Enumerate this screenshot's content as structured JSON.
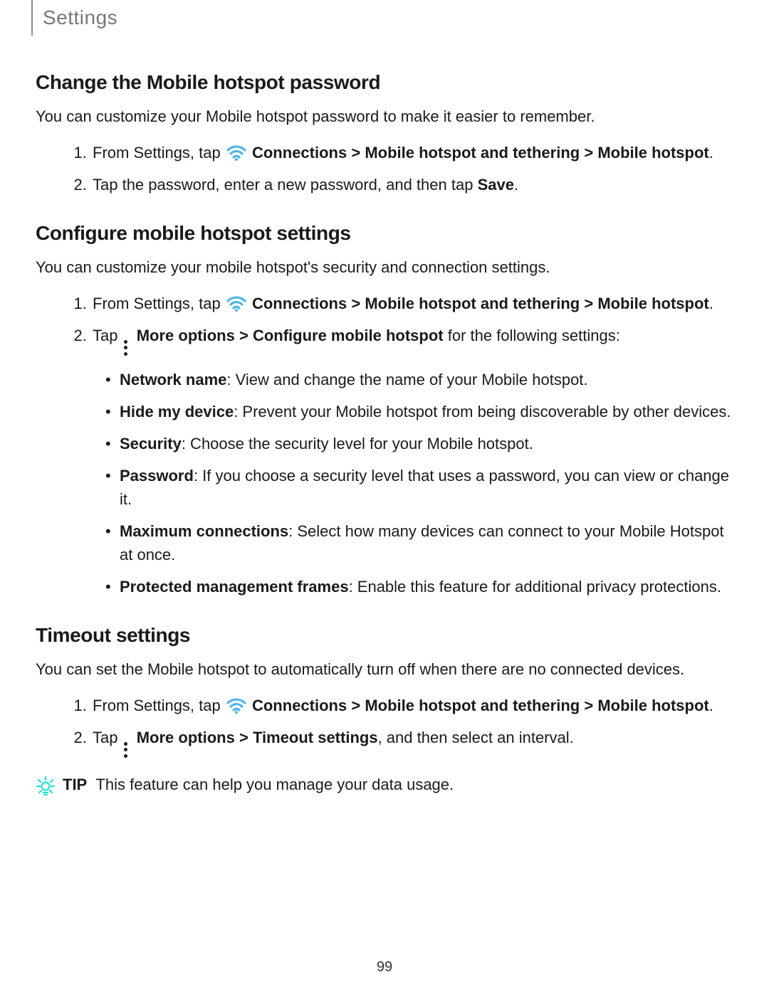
{
  "header": {
    "section": "Settings"
  },
  "sections": {
    "s1": {
      "title": "Change the Mobile hotspot password",
      "intro": "You can customize your Mobile hotspot password to make it easier to remember.",
      "step1_a": "From Settings, tap ",
      "step1_b": "Connections",
      "step1_c": "Mobile hotspot and tethering",
      "step1_d": "Mobile hotspot",
      "step2_a": "Tap the password, enter a new password, and then tap ",
      "step2_b": "Save"
    },
    "s2": {
      "title": "Configure mobile hotspot settings",
      "intro": "You can customize your mobile hotspot's security and connection settings.",
      "step1_a": "From Settings, tap ",
      "step1_b": "Connections",
      "step1_c": "Mobile hotspot and tethering",
      "step1_d": "Mobile hotspot",
      "step2_a": "Tap ",
      "step2_b": "More options",
      "step2_c": "Configure mobile hotspot",
      "step2_d": " for the following settings:",
      "bullets": {
        "b1a": "Network name",
        "b1b": ": View and change the name of your Mobile hotspot.",
        "b2a": "Hide my device",
        "b2b": ": Prevent your Mobile hotspot from being discoverable by other devices.",
        "b3a": "Security",
        "b3b": ": Choose the security level for your Mobile hotspot.",
        "b4a": "Password",
        "b4b": ": If you choose a security level that uses a password, you can view or change it.",
        "b5a": "Maximum connections",
        "b5b": ": Select how many devices can connect to your Mobile Hotspot at once.",
        "b6a": "Protected management frames",
        "b6b": ": Enable this feature for additional privacy protections."
      }
    },
    "s3": {
      "title": "Timeout settings",
      "intro": "You can set the Mobile hotspot to automatically turn off when there are no connected devices.",
      "step1_a": "From Settings, tap ",
      "step1_b": "Connections",
      "step1_c": "Mobile hotspot and tethering",
      "step1_d": "Mobile hotspot",
      "step2_a": "Tap ",
      "step2_b": "More options",
      "step2_c": "Timeout settings",
      "step2_d": ", and then select an interval."
    }
  },
  "tip": {
    "label": "TIP",
    "text": "This feature can help you manage your data usage."
  },
  "glyphs": {
    "chevron": ">"
  },
  "colors": {
    "wifi": "#4db5e5",
    "tip": "#22e0d8"
  },
  "pageNumber": "99"
}
